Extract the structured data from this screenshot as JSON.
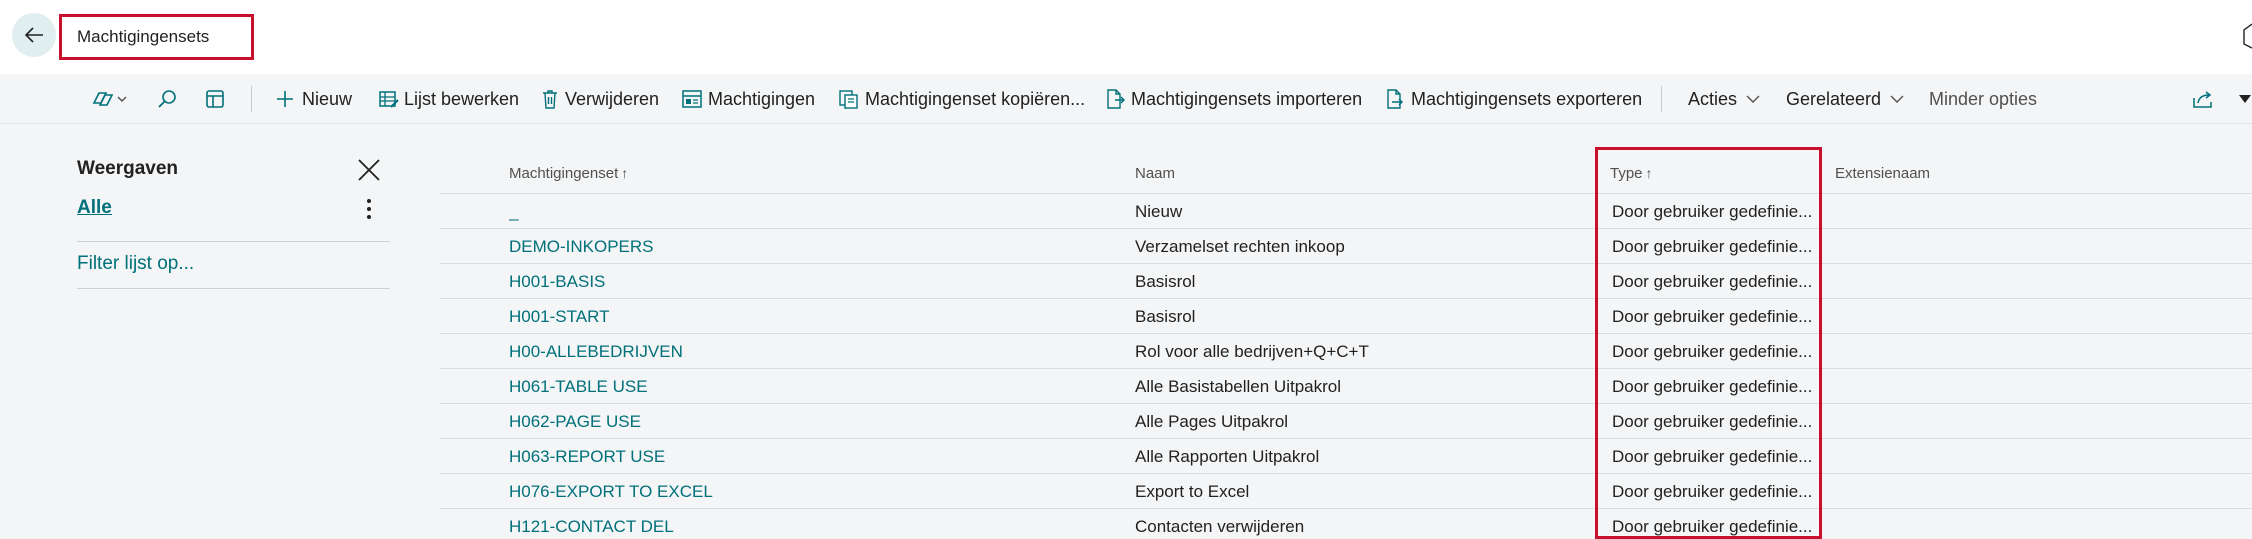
{
  "header": {
    "back_label": "Terug",
    "page_title": "Machtigingensets"
  },
  "toolbar": {
    "icons": [
      "copilot-icon",
      "search-icon",
      "grid-icon"
    ],
    "new_label": "Nieuw",
    "edit_list_label": "Lijst bewerken",
    "delete_label": "Verwijderen",
    "permissions_label": "Machtigingen",
    "copy_label": "Machtigingenset kopiëren...",
    "import_label": "Machtigingensets importeren",
    "export_label": "Machtigingensets exporteren",
    "actions_label": "Acties",
    "related_label": "Gerelateerd",
    "fewer_options_label": "Minder opties"
  },
  "sidebar": {
    "title": "Weergaven",
    "view_all": "Alle",
    "filter_link": "Filter lijst op..."
  },
  "table": {
    "columns": [
      {
        "label": "Machtigingenset",
        "sort": "↑"
      },
      {
        "label": "Naam",
        "sort": ""
      },
      {
        "label": "Type",
        "sort": "↑"
      },
      {
        "label": "Extensienaam",
        "sort": ""
      }
    ],
    "rows": [
      {
        "id": "_",
        "name": "Nieuw",
        "type": "Door gebruiker gedefinie...",
        "ext": ""
      },
      {
        "id": "DEMO-INKOPERS",
        "name": "Verzamelset rechten inkoop",
        "type": "Door gebruiker gedefinie...",
        "ext": ""
      },
      {
        "id": "H001-BASIS",
        "name": "Basisrol",
        "type": "Door gebruiker gedefinie...",
        "ext": ""
      },
      {
        "id": "H001-START",
        "name": "Basisrol",
        "type": "Door gebruiker gedefinie...",
        "ext": ""
      },
      {
        "id": "H00-ALLEBEDRIJVEN",
        "name": "Rol voor alle bedrijven+Q+C+T",
        "type": "Door gebruiker gedefinie...",
        "ext": ""
      },
      {
        "id": "H061-TABLE USE",
        "name": "Alle Basistabellen Uitpakrol",
        "type": "Door gebruiker gedefinie...",
        "ext": ""
      },
      {
        "id": "H062-PAGE USE",
        "name": "Alle Pages Uitpakrol",
        "type": "Door gebruiker gedefinie...",
        "ext": ""
      },
      {
        "id": "H063-REPORT USE",
        "name": "Alle Rapporten Uitpakrol",
        "type": "Door gebruiker gedefinie...",
        "ext": ""
      },
      {
        "id": "H076-EXPORT TO EXCEL",
        "name": "Export to Excel",
        "type": "Door gebruiker gedefinie...",
        "ext": ""
      },
      {
        "id": "H121-CONTACT DEL",
        "name": "Contacten verwijderen",
        "type": "Door gebruiker gedefinie...",
        "ext": ""
      }
    ]
  },
  "colors": {
    "accent": "#00707a",
    "highlight": "#c8102e",
    "background": "#f4f5f6"
  }
}
